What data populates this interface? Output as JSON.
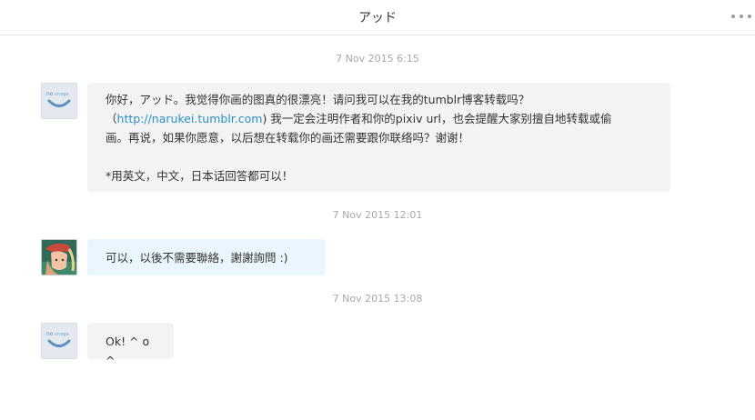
{
  "header": {
    "title": "アッド",
    "more_icon": "more-horizontal-icon"
  },
  "messages": [
    {
      "timestamp": "7 Nov 2015 6:15",
      "sender": "self",
      "avatar_icon": "default-avatar-icon",
      "line1": "你好，アッド。我觉得你画的图真的很漂亮！请问我可以在我的tumblr博客转载吗？",
      "line2_pre": "（",
      "link_text": "http://narukei.tumblr.com",
      "line2_post": ") 我一定会注明作者和你的pixiv url，也会提醒大家别擅自地转载或偷",
      "line3": "画。再说，如果你愿意，以后想在转载你的画还需要跟你联络吗？谢谢！",
      "line4": "*用英文，中文，日本话回答都可以！"
    },
    {
      "timestamp": "7 Nov 2015 12:01",
      "sender": "other",
      "avatar_icon": "user-avatar-image",
      "text": "可以，以後不需要聯絡，謝謝詢問 :)"
    },
    {
      "timestamp": "7 Nov 2015 13:08",
      "sender": "self",
      "avatar_icon": "default-avatar-icon",
      "text": "Ok! ^ o ^"
    }
  ],
  "colors": {
    "link": "#2b8fc7",
    "incoming_bubble": "#f3f3f3",
    "outgoing_bubble": "#eaf6fd",
    "timestamp": "#a8a8a8"
  }
}
